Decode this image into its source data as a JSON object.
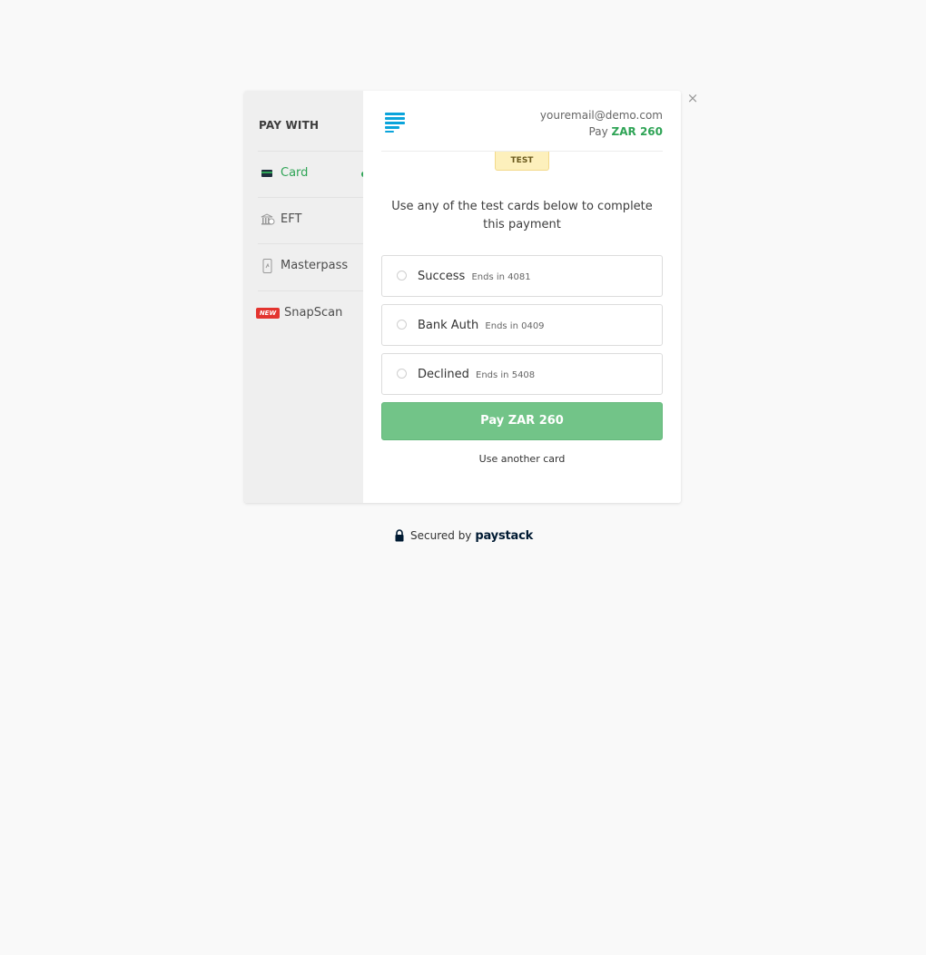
{
  "sidebar": {
    "title": "PAY WITH",
    "items": [
      {
        "label": "Card",
        "icon": "card-icon",
        "active": true
      },
      {
        "label": "EFT",
        "icon": "bank-icon",
        "active": false
      },
      {
        "label": "Masterpass",
        "icon": "mobile-icon",
        "active": false
      },
      {
        "label": "SnapScan",
        "icon": "snapscan-icon",
        "badge": "NEW",
        "active": false
      }
    ]
  },
  "header": {
    "email": "youremail@demo.com",
    "pay_prefix": "Pay",
    "amount": "ZAR 260",
    "test_badge": "TEST"
  },
  "main": {
    "instruction": "Use any of the test cards below to complete this payment",
    "cards": [
      {
        "name": "Success",
        "ends": "Ends in 4081"
      },
      {
        "name": "Bank Auth",
        "ends": "Ends in 0409"
      },
      {
        "name": "Declined",
        "ends": "Ends in 5408"
      }
    ],
    "pay_button": "Pay ZAR 260",
    "another_card": "Use another card"
  },
  "footer": {
    "secured_text": "Secured by",
    "brand": "paystack"
  },
  "colors": {
    "accent": "#2fa456",
    "pay_button": "#72c488",
    "badge_new": "#e3342f",
    "test_badge": "#fdf0bc"
  }
}
